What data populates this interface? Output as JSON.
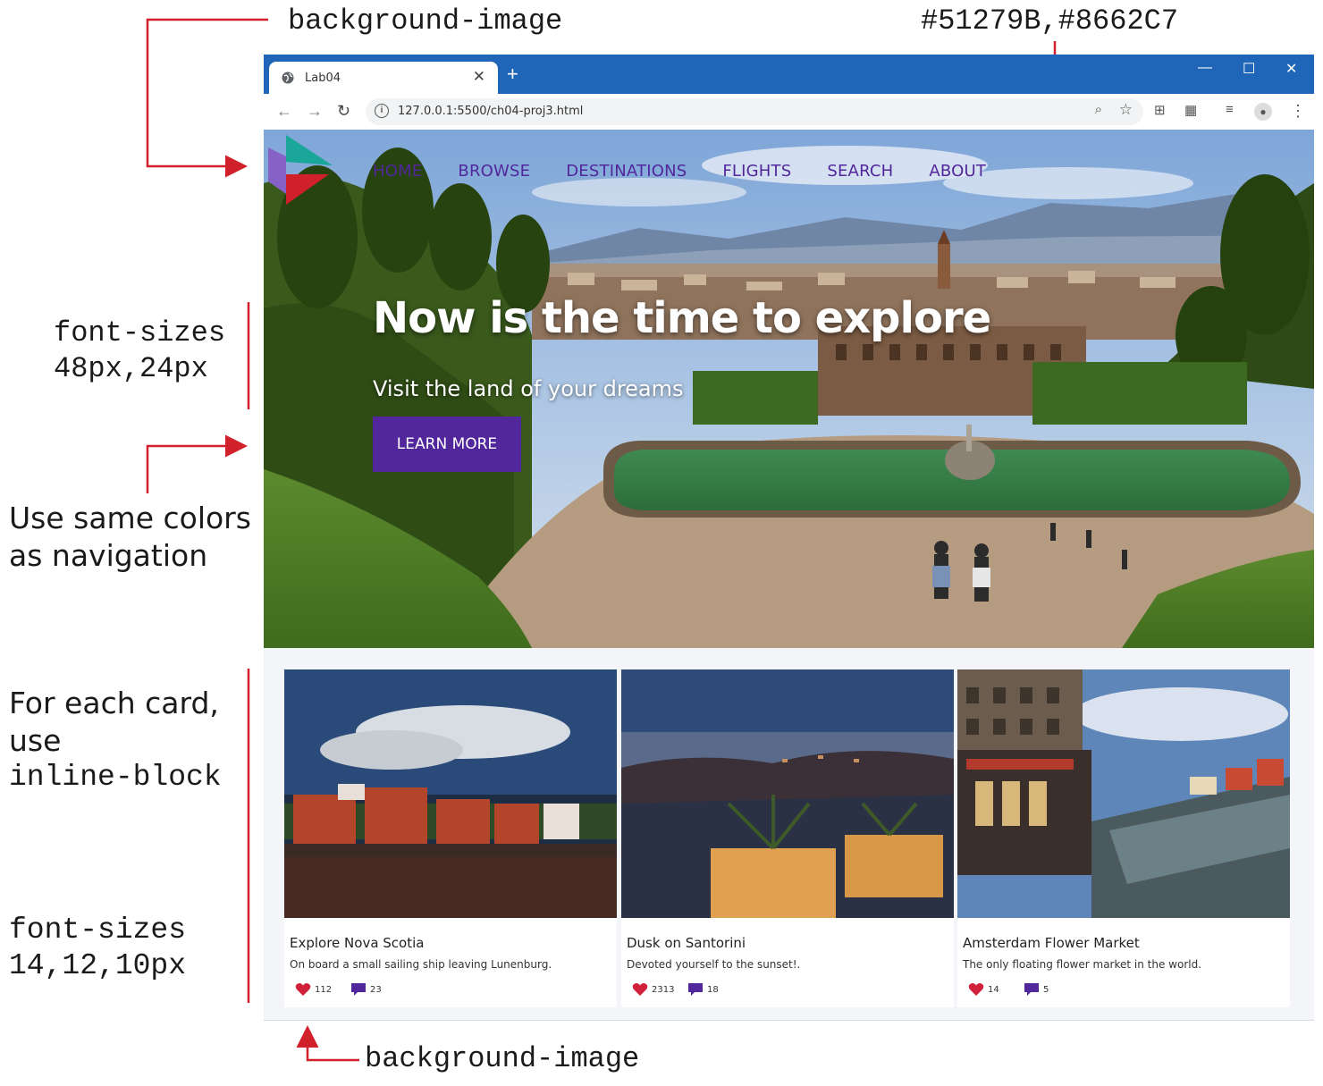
{
  "annotations": {
    "top_left": "background-image",
    "top_right": "#51279B,#8662C7",
    "font_sizes_hero_line1": "font-sizes",
    "font_sizes_hero_line2": "48px,24px",
    "same_colors_line1": "Use same colors",
    "same_colors_line2": "as navigation",
    "card_note_line1": "For each card,",
    "card_note_line2": "use",
    "card_note_line3": "inline-block",
    "font_sizes_card_line1": "font-sizes",
    "font_sizes_card_line2": "14,12,10px",
    "bottom": "background-image"
  },
  "browser": {
    "tab_title": "Lab04",
    "tab_close": "✕",
    "new_tab": "+",
    "minimize": "—",
    "maximize": "☐",
    "close": "✕",
    "back": "←",
    "forward": "→",
    "reload": "↻",
    "url": "127.0.0.1:5500/ch04-proj3.html",
    "menu": "⋮"
  },
  "nav": {
    "items": [
      "HOME",
      "BROWSE",
      "DESTINATIONS",
      "FLIGHTS",
      "SEARCH",
      "ABOUT"
    ]
  },
  "hero": {
    "title": "Now is the time to explore",
    "subtitle": "Visit the land of your dreams",
    "button": "LEARN MORE"
  },
  "cards": [
    {
      "title": "Explore Nova Scotia",
      "description": "On board a small sailing ship leaving Lunenburg.",
      "likes": "112",
      "comments": "23"
    },
    {
      "title": "Dusk on Santorini",
      "description": "Devoted yourself to the sunset!.",
      "likes": "2313",
      "comments": "18"
    },
    {
      "title": "Amsterdam Flower Market",
      "description": "The only floating flower market in the world.",
      "likes": "14",
      "comments": "5"
    }
  ],
  "colors": {
    "nav_primary": "#51279B",
    "nav_secondary": "#8662C7",
    "annotation_red": "#d0202a",
    "browser_blue": "#1f66b8"
  }
}
